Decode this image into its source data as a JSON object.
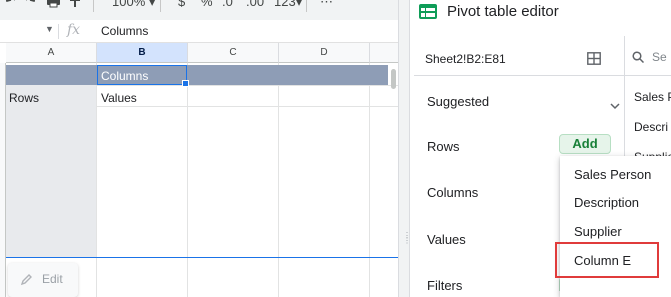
{
  "toolbar": {
    "zoom": "100%",
    "currency_symbol": "$",
    "percent_symbol": "%",
    "decrease_decimal": ".0",
    "increase_decimal": ".00",
    "number_format": "123",
    "more": "⋯"
  },
  "formula_bar": {
    "fx_label": "fx",
    "value": "Columns"
  },
  "grid": {
    "column_headers": [
      "A",
      "B",
      "C",
      "D"
    ],
    "selected_column": "B",
    "cells": {
      "b_band": "Columns",
      "a_row": "Rows",
      "b_row": "Values"
    },
    "band_color": "#8e9db6",
    "edit_label": "Edit"
  },
  "pivot_editor": {
    "title": "Pivot table editor",
    "range": "Sheet2!B2:E81",
    "sections": {
      "suggested": "Suggested",
      "rows": "Rows",
      "columns": "Columns",
      "values": "Values",
      "filters": "Filters"
    },
    "add_label": "Add",
    "fields_search_placeholder": "Se",
    "fields": [
      "Sales P",
      "Descri",
      "Supplie"
    ]
  },
  "dropdown": {
    "items": [
      "Sales Person",
      "Description",
      "Supplier",
      "Column E"
    ],
    "highlighted_item": "Column E",
    "highlight_color": "#e03b3b"
  },
  "colors": {
    "accent_green": "#188038",
    "selection_blue": "#1a73e8",
    "sheets_green": "#0f9d58"
  }
}
